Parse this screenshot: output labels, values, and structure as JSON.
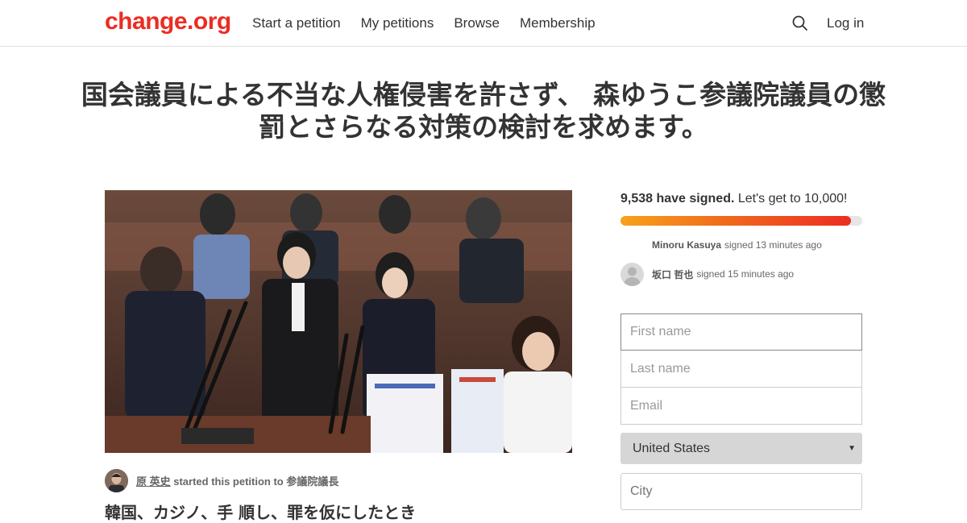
{
  "header": {
    "logo": "change.org",
    "nav": [
      "Start a petition",
      "My petitions",
      "Browse",
      "Membership"
    ],
    "login": "Log in"
  },
  "petition": {
    "title": "国会議員による不当な人権侵害を許さず、 森ゆうこ参議院議員の懲罰とさらなる対策の検討を求めます。",
    "starter_name": "原 英史",
    "starter_middle": " started this petition to ",
    "starter_target": "参議院議長",
    "body_start": "韓国、カジノ、手 順し、罪を仮にしたとき"
  },
  "signatures": {
    "count_label": "9,538 have signed.",
    "goal_label": " Let's get to 10,000!",
    "progress": 0.9538,
    "recent": [
      {
        "name": "Minoru Kasuya",
        "time": "signed 13 minutes ago"
      },
      {
        "name": "坂口 哲也",
        "time": "signed 15 minutes ago"
      }
    ]
  },
  "form": {
    "first_name_placeholder": "First name",
    "last_name_placeholder": "Last name",
    "email_placeholder": "Email",
    "country": "United States",
    "city_placeholder": "City"
  },
  "colors": {
    "brand": "#ec2c22",
    "progress_start": "#f7a21b",
    "progress_end": "#ec2c22"
  }
}
